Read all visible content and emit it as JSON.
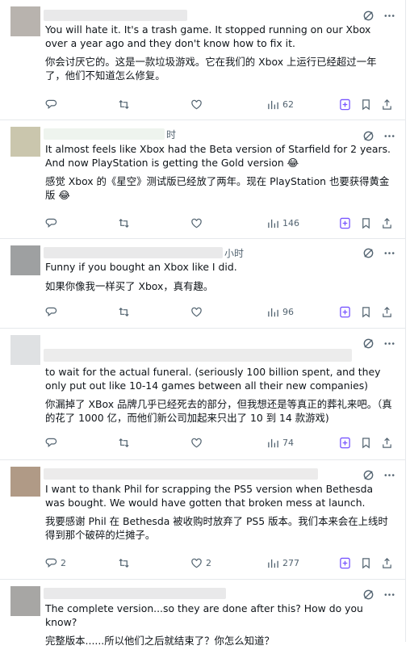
{
  "tweets": [
    {
      "header_suffix": "",
      "en": "You will hate it. It's a trash game. It stopped running on our Xbox over a year ago and they don't know how to fix it.",
      "zh": "你会讨厌它的。这是一款垃圾游戏。它在我们的 Xbox 上运行已经超过一年了，他们不知道怎么修复。",
      "replies": "",
      "views": "62"
    },
    {
      "header_suffix": "时",
      "en": "It almost feels like Xbox had the Beta version of Starfield for 2 years.  And now PlayStation is getting the Gold version 😂",
      "zh": "感觉 Xbox 的《星空》测试版已经放了两年。现在 PlayStation 也要获得黄金版 😂",
      "replies": "",
      "views": "146"
    },
    {
      "header_suffix": "小时",
      "en": "Funny if you bought an Xbox like I did.",
      "zh": "如果你像我一样买了 Xbox，真有趣。",
      "replies": "",
      "views": "96"
    },
    {
      "header_suffix": "",
      "en": "to wait for the actual funeral.  (seriously 100 billion spent, and they only put out like 10-14 games between all their new companies)",
      "zh": "你漏掉了 XBox 品牌几乎已经死去的部分，但我想还是等真正的葬礼来吧。（真的花了 1000 亿，而他们新公司加起来只出了 10 到 14 款游戏)",
      "replies": "",
      "views": "74"
    },
    {
      "header_suffix": "",
      "en": "I want to thank Phil for scrapping the PS5 version when Bethesda was bought. We would have gotten that broken mess at launch.",
      "zh": "我要感谢 Phil 在 Bethesda 被收购时放弃了 PS5 版本。我们本来会在上线时得到那个破碎的烂摊子。",
      "replies": "2",
      "views": "277"
    },
    {
      "header_suffix": "",
      "en": "The complete version...so they are done after this? How do you know?",
      "zh": "完整版本......所以他们之后就结束了？你怎么知道？",
      "replies": "",
      "views": ""
    }
  ],
  "icons": {
    "grok": "grok-icon",
    "more": "more-icon",
    "reply": "reply-icon",
    "retweet": "retweet-icon",
    "like": "like-icon",
    "views": "views-icon",
    "grok_action": "grok-explain-icon",
    "bookmark": "bookmark-icon",
    "share": "share-icon"
  },
  "colors": {
    "text": "#0f1419",
    "secondary": "#536471",
    "grok_accent": "#7856ff",
    "divider": "#e6e9ec"
  }
}
